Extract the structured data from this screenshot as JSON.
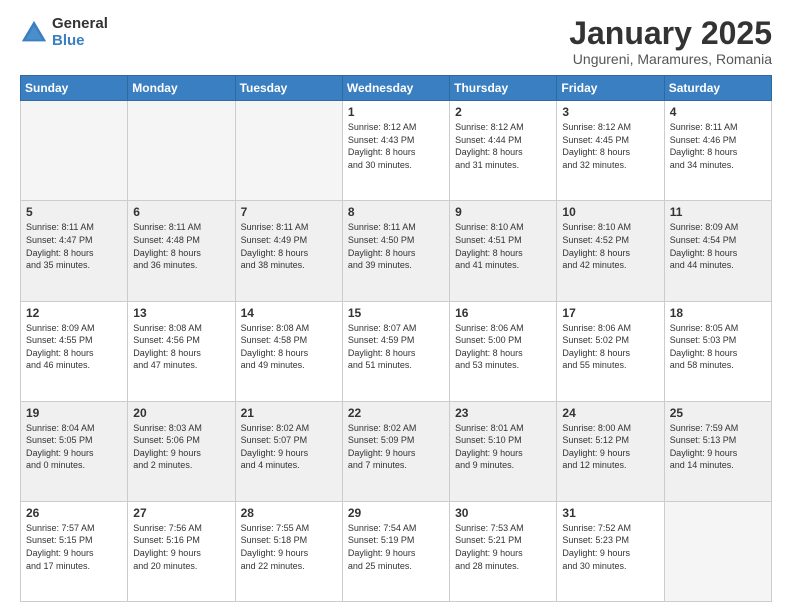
{
  "logo": {
    "general": "General",
    "blue": "Blue"
  },
  "title": "January 2025",
  "subtitle": "Ungureni, Maramures, Romania",
  "days_of_week": [
    "Sunday",
    "Monday",
    "Tuesday",
    "Wednesday",
    "Thursday",
    "Friday",
    "Saturday"
  ],
  "weeks": [
    [
      {
        "day": "",
        "info": "",
        "empty": true
      },
      {
        "day": "",
        "info": "",
        "empty": true
      },
      {
        "day": "",
        "info": "",
        "empty": true
      },
      {
        "day": "1",
        "info": "Sunrise: 8:12 AM\nSunset: 4:43 PM\nDaylight: 8 hours\nand 30 minutes."
      },
      {
        "day": "2",
        "info": "Sunrise: 8:12 AM\nSunset: 4:44 PM\nDaylight: 8 hours\nand 31 minutes."
      },
      {
        "day": "3",
        "info": "Sunrise: 8:12 AM\nSunset: 4:45 PM\nDaylight: 8 hours\nand 32 minutes."
      },
      {
        "day": "4",
        "info": "Sunrise: 8:11 AM\nSunset: 4:46 PM\nDaylight: 8 hours\nand 34 minutes."
      }
    ],
    [
      {
        "day": "5",
        "info": "Sunrise: 8:11 AM\nSunset: 4:47 PM\nDaylight: 8 hours\nand 35 minutes.",
        "shaded": true
      },
      {
        "day": "6",
        "info": "Sunrise: 8:11 AM\nSunset: 4:48 PM\nDaylight: 8 hours\nand 36 minutes.",
        "shaded": true
      },
      {
        "day": "7",
        "info": "Sunrise: 8:11 AM\nSunset: 4:49 PM\nDaylight: 8 hours\nand 38 minutes.",
        "shaded": true
      },
      {
        "day": "8",
        "info": "Sunrise: 8:11 AM\nSunset: 4:50 PM\nDaylight: 8 hours\nand 39 minutes.",
        "shaded": true
      },
      {
        "day": "9",
        "info": "Sunrise: 8:10 AM\nSunset: 4:51 PM\nDaylight: 8 hours\nand 41 minutes.",
        "shaded": true
      },
      {
        "day": "10",
        "info": "Sunrise: 8:10 AM\nSunset: 4:52 PM\nDaylight: 8 hours\nand 42 minutes.",
        "shaded": true
      },
      {
        "day": "11",
        "info": "Sunrise: 8:09 AM\nSunset: 4:54 PM\nDaylight: 8 hours\nand 44 minutes.",
        "shaded": true
      }
    ],
    [
      {
        "day": "12",
        "info": "Sunrise: 8:09 AM\nSunset: 4:55 PM\nDaylight: 8 hours\nand 46 minutes."
      },
      {
        "day": "13",
        "info": "Sunrise: 8:08 AM\nSunset: 4:56 PM\nDaylight: 8 hours\nand 47 minutes."
      },
      {
        "day": "14",
        "info": "Sunrise: 8:08 AM\nSunset: 4:58 PM\nDaylight: 8 hours\nand 49 minutes."
      },
      {
        "day": "15",
        "info": "Sunrise: 8:07 AM\nSunset: 4:59 PM\nDaylight: 8 hours\nand 51 minutes."
      },
      {
        "day": "16",
        "info": "Sunrise: 8:06 AM\nSunset: 5:00 PM\nDaylight: 8 hours\nand 53 minutes."
      },
      {
        "day": "17",
        "info": "Sunrise: 8:06 AM\nSunset: 5:02 PM\nDaylight: 8 hours\nand 55 minutes."
      },
      {
        "day": "18",
        "info": "Sunrise: 8:05 AM\nSunset: 5:03 PM\nDaylight: 8 hours\nand 58 minutes."
      }
    ],
    [
      {
        "day": "19",
        "info": "Sunrise: 8:04 AM\nSunset: 5:05 PM\nDaylight: 9 hours\nand 0 minutes.",
        "shaded": true
      },
      {
        "day": "20",
        "info": "Sunrise: 8:03 AM\nSunset: 5:06 PM\nDaylight: 9 hours\nand 2 minutes.",
        "shaded": true
      },
      {
        "day": "21",
        "info": "Sunrise: 8:02 AM\nSunset: 5:07 PM\nDaylight: 9 hours\nand 4 minutes.",
        "shaded": true
      },
      {
        "day": "22",
        "info": "Sunrise: 8:02 AM\nSunset: 5:09 PM\nDaylight: 9 hours\nand 7 minutes.",
        "shaded": true
      },
      {
        "day": "23",
        "info": "Sunrise: 8:01 AM\nSunset: 5:10 PM\nDaylight: 9 hours\nand 9 minutes.",
        "shaded": true
      },
      {
        "day": "24",
        "info": "Sunrise: 8:00 AM\nSunset: 5:12 PM\nDaylight: 9 hours\nand 12 minutes.",
        "shaded": true
      },
      {
        "day": "25",
        "info": "Sunrise: 7:59 AM\nSunset: 5:13 PM\nDaylight: 9 hours\nand 14 minutes.",
        "shaded": true
      }
    ],
    [
      {
        "day": "26",
        "info": "Sunrise: 7:57 AM\nSunset: 5:15 PM\nDaylight: 9 hours\nand 17 minutes."
      },
      {
        "day": "27",
        "info": "Sunrise: 7:56 AM\nSunset: 5:16 PM\nDaylight: 9 hours\nand 20 minutes."
      },
      {
        "day": "28",
        "info": "Sunrise: 7:55 AM\nSunset: 5:18 PM\nDaylight: 9 hours\nand 22 minutes."
      },
      {
        "day": "29",
        "info": "Sunrise: 7:54 AM\nSunset: 5:19 PM\nDaylight: 9 hours\nand 25 minutes."
      },
      {
        "day": "30",
        "info": "Sunrise: 7:53 AM\nSunset: 5:21 PM\nDaylight: 9 hours\nand 28 minutes."
      },
      {
        "day": "31",
        "info": "Sunrise: 7:52 AM\nSunset: 5:23 PM\nDaylight: 9 hours\nand 30 minutes."
      },
      {
        "day": "",
        "info": "",
        "empty": true
      }
    ]
  ]
}
